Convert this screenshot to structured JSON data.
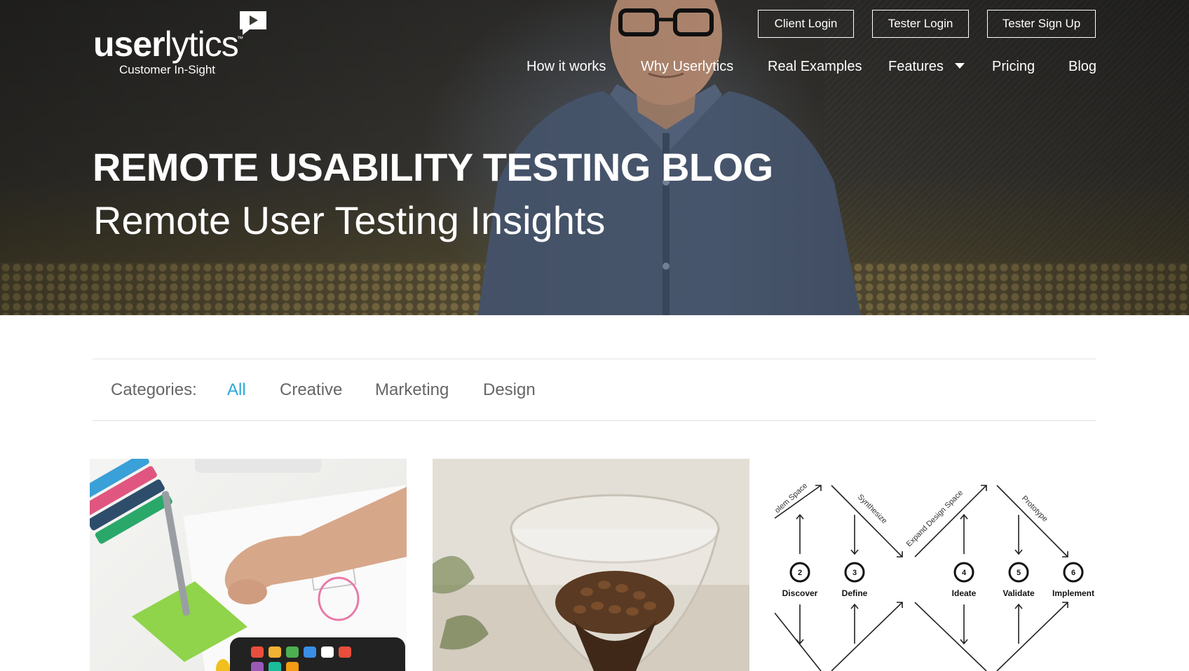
{
  "brand": {
    "name_bold": "user",
    "name_light": "lytics",
    "trademark": "™",
    "tagline": "Customer In-Sight"
  },
  "top_buttons": {
    "client_login": "Client Login",
    "tester_login": "Tester Login",
    "tester_signup": "Tester Sign Up"
  },
  "nav": {
    "items": [
      "How it works",
      "Why Userlytics",
      "Real Examples",
      "Features",
      "Pricing",
      "Blog"
    ]
  },
  "hero": {
    "title": "REMOTE USABILITY TESTING BLOG",
    "subtitle": "Remote User Testing Insights"
  },
  "categories": {
    "label": "Categories:",
    "items": [
      "All",
      "Creative",
      "Marketing",
      "Design"
    ],
    "active": "All"
  },
  "diagram": {
    "steps": [
      {
        "number": "2",
        "label": "Discover"
      },
      {
        "number": "3",
        "label": "Define"
      },
      {
        "number": "4",
        "label": "Ideate"
      },
      {
        "number": "5",
        "label": "Validate"
      },
      {
        "number": "6",
        "label": "Implement"
      }
    ],
    "diagonal_labels": [
      "olem Space",
      "Synthesize",
      "Expand Design Space",
      "Prototype"
    ]
  },
  "colors": {
    "accent": "#2aa8dc",
    "category_text": "#666666",
    "divider": "#e2e2e2"
  }
}
